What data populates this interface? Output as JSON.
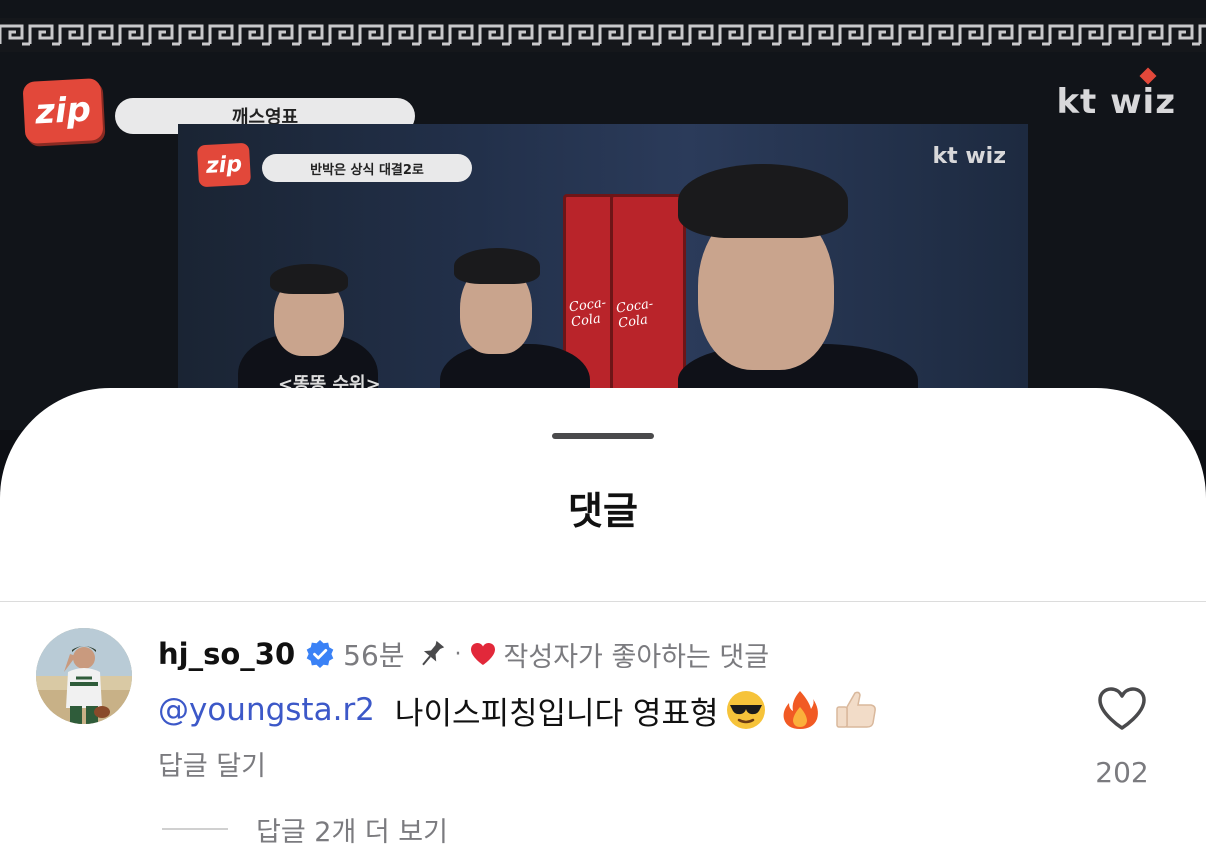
{
  "video": {
    "show_logo": "zip",
    "caption": "깨스영표",
    "brand": "kt wiz",
    "inner_show_logo": "zip",
    "inner_caption": "반박은 상식 대결2로",
    "inner_brand": "kt wiz",
    "fridge_label": "Coca-Cola",
    "subtitle": "<똥똥 수위>"
  },
  "sheet": {
    "title": "댓글"
  },
  "comment": {
    "avatar_icon": "avatar-photo",
    "username": "hj_so_30",
    "verified_icon": "verified-badge-icon",
    "time": "56분",
    "pin_icon": "pin-icon",
    "separator": "·",
    "creator_liked_icon": "red-heart-icon",
    "creator_liked_text": "작성자가 좋아하는 댓글",
    "mention": "@youngsta.r2",
    "text": "나이스피칭입니다 영표형",
    "emojis": [
      "sunglasses-emoji",
      "fire-emoji",
      "thumbs-up-emoji"
    ],
    "reply_label": "답글 달기",
    "like_icon": "heart-outline-icon",
    "like_count": "202",
    "more_replies_label": "답글 2개 더 보기"
  },
  "colors": {
    "mention": "#3c58c8",
    "secondary_text": "#7b7b7f",
    "verified": "#3b82f6",
    "heart": "#e2283a"
  }
}
